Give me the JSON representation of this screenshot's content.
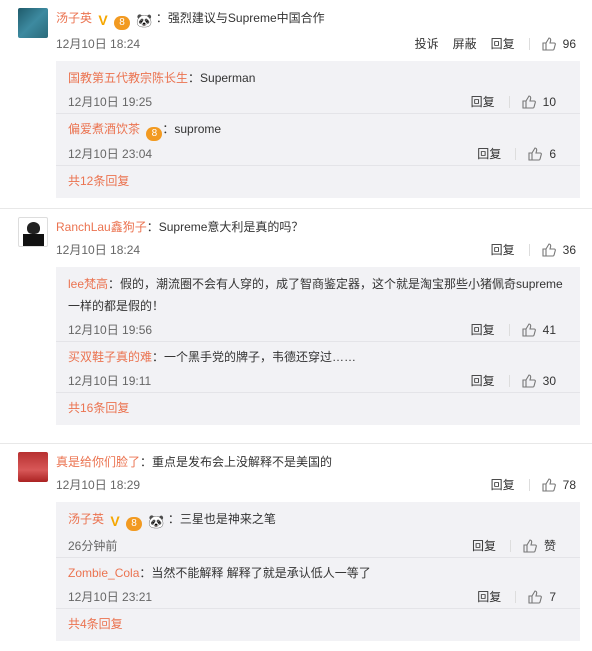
{
  "comments": [
    {
      "user": "汤子英",
      "text": "：强烈建议与Supreme中国合作",
      "time": "12月10日 18:24",
      "report": "投诉",
      "block": "屏蔽",
      "reply": "回复",
      "likes": "96",
      "replies": [
        {
          "user": "国教第五代教宗陈长生",
          "text": "：Superman",
          "time": "12月10日 19:25",
          "reply": "回复",
          "likes": "10"
        },
        {
          "user": "偏爱煮酒饮茶",
          "text": "：suprome",
          "time": "12月10日 23:04",
          "reply": "回复",
          "likes": "6"
        }
      ],
      "more": "共12条回复"
    },
    {
      "user": "RanchLau鑫狗子",
      "text": "：Supreme意大利是真的吗？",
      "time": "12月10日 18:24",
      "reply": "回复",
      "likes": "36",
      "replies": [
        {
          "user": "lee梵高",
          "text": "：假的，潮流圈不会有人穿的，成了智商鉴定器，这个就是淘宝那些小猪佩奇supreme一样的都是假的！",
          "time": "12月10日 19:56",
          "reply": "回复",
          "likes": "41"
        },
        {
          "user": "买双鞋子真的难",
          "text": "：一个黑手党的牌子，韦德还穿过……",
          "time": "12月10日 19:11",
          "reply": "回复",
          "likes": "30"
        }
      ],
      "more": "共16条回复"
    },
    {
      "user": "真是给你们脸了",
      "text": "：重点是发布会上没解释不是美国的",
      "time": "12月10日 18:29",
      "reply": "回复",
      "likes": "78",
      "replies": [
        {
          "user": "汤子英",
          "text": "：三星也是神来之笔",
          "time": "26分钟前",
          "reply": "回复",
          "likes": "赞"
        },
        {
          "user": "Zombie_Cola",
          "text": "：当然不能解释 解释了就是承认低人一等了",
          "time": "12月10日 23:21",
          "reply": "回复",
          "likes": "7"
        }
      ],
      "more": "共4条回复"
    }
  ],
  "badges": {
    "vip": "V",
    "year": "8",
    "panda": "🐼"
  },
  "colors": {
    "name": "#eb7350",
    "badge": "#f29a21"
  }
}
